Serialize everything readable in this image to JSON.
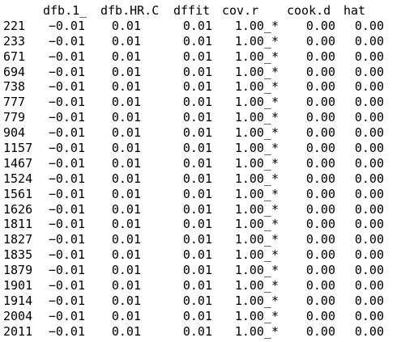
{
  "table": {
    "columns": [
      "dfb.1_",
      "dfb.HR.C",
      "dffit",
      "cov.r",
      "cook.d",
      "hat"
    ],
    "rows": [
      {
        "id": "221",
        "values": [
          "-0.01",
          "0.01",
          "0.01",
          "1.00_*",
          "0.00",
          "0.00"
        ]
      },
      {
        "id": "233",
        "values": [
          "-0.01",
          "0.01",
          "0.01",
          "1.00_*",
          "0.00",
          "0.00"
        ]
      },
      {
        "id": "671",
        "values": [
          "-0.01",
          "0.01",
          "0.01",
          "1.00_*",
          "0.00",
          "0.00"
        ]
      },
      {
        "id": "694",
        "values": [
          "-0.01",
          "0.01",
          "0.01",
          "1.00_*",
          "0.00",
          "0.00"
        ]
      },
      {
        "id": "738",
        "values": [
          "-0.01",
          "0.01",
          "0.01",
          "1.00_*",
          "0.00",
          "0.00"
        ]
      },
      {
        "id": "777",
        "values": [
          "-0.01",
          "0.01",
          "0.01",
          "1.00_*",
          "0.00",
          "0.00"
        ]
      },
      {
        "id": "779",
        "values": [
          "-0.01",
          "0.01",
          "0.01",
          "1.00_*",
          "0.00",
          "0.00"
        ]
      },
      {
        "id": "904",
        "values": [
          "-0.01",
          "0.01",
          "0.01",
          "1.00_*",
          "0.00",
          "0.00"
        ]
      },
      {
        "id": "1157",
        "values": [
          "-0.01",
          "0.01",
          "0.01",
          "1.00_*",
          "0.00",
          "0.00"
        ]
      },
      {
        "id": "1467",
        "values": [
          "-0.01",
          "0.01",
          "0.01",
          "1.00_*",
          "0.00",
          "0.00"
        ]
      },
      {
        "id": "1524",
        "values": [
          "-0.01",
          "0.01",
          "0.01",
          "1.00_*",
          "0.00",
          "0.00"
        ]
      },
      {
        "id": "1561",
        "values": [
          "-0.01",
          "0.01",
          "0.01",
          "1.00_*",
          "0.00",
          "0.00"
        ]
      },
      {
        "id": "1626",
        "values": [
          "-0.01",
          "0.01",
          "0.01",
          "1.00_*",
          "0.00",
          "0.00"
        ]
      },
      {
        "id": "1811",
        "values": [
          "-0.01",
          "0.01",
          "0.01",
          "1.00_*",
          "0.00",
          "0.00"
        ]
      },
      {
        "id": "1827",
        "values": [
          "-0.01",
          "0.01",
          "0.01",
          "1.00_*",
          "0.00",
          "0.00"
        ]
      },
      {
        "id": "1835",
        "values": [
          "-0.01",
          "0.01",
          "0.01",
          "1.00_*",
          "0.00",
          "0.00"
        ]
      },
      {
        "id": "1879",
        "values": [
          "-0.01",
          "0.01",
          "0.01",
          "1.00_*",
          "0.00",
          "0.00"
        ]
      },
      {
        "id": "1901",
        "values": [
          "-0.01",
          "0.01",
          "0.01",
          "1.00_*",
          "0.00",
          "0.00"
        ]
      },
      {
        "id": "1914",
        "values": [
          "-0.01",
          "0.01",
          "0.01",
          "1.00_*",
          "0.00",
          "0.00"
        ]
      },
      {
        "id": "2004",
        "values": [
          "-0.01",
          "0.01",
          "0.01",
          "1.00_*",
          "0.00",
          "0.00"
        ]
      },
      {
        "id": "2011",
        "values": [
          "-0.01",
          "0.01",
          "0.01",
          "1.00_*",
          "0.00",
          "0.00"
        ]
      }
    ]
  }
}
